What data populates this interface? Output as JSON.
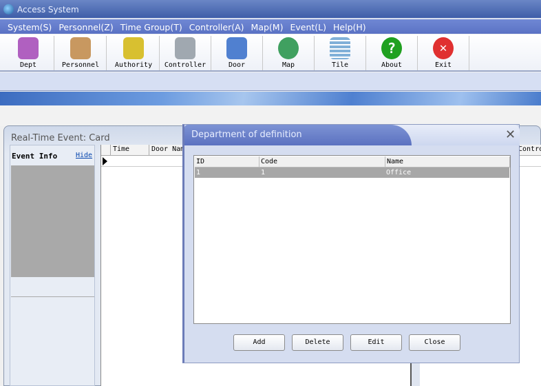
{
  "window": {
    "title": "Access System"
  },
  "menu": [
    "System(S)",
    "Personnel(Z)",
    "Time Group(T)",
    "Controller(A)",
    "Map(M)",
    "Event(L)",
    "Help(H)"
  ],
  "toolbar": [
    {
      "label": "Dept",
      "icon": "dept-icon",
      "color": "#b060c0"
    },
    {
      "label": "Personnel",
      "icon": "personnel-icon",
      "color": "#c89860"
    },
    {
      "label": "Authority",
      "icon": "authority-icon",
      "color": "#d8c030"
    },
    {
      "label": "Controller",
      "icon": "controller-icon",
      "color": "#a0a8b0"
    },
    {
      "label": "Door",
      "icon": "door-icon",
      "color": "#5080d0"
    },
    {
      "label": "Map",
      "icon": "map-icon",
      "color": "#40a060"
    },
    {
      "label": "Tile",
      "icon": "tile-icon",
      "color": "#80b0d8"
    },
    {
      "label": "About",
      "icon": "about-icon",
      "color": "#20a020"
    },
    {
      "label": "Exit",
      "icon": "exit-icon",
      "color": "#e03030"
    }
  ],
  "panel": {
    "title": "Real-Time Event: Card",
    "event_info": "Event Info",
    "hide": "Hide",
    "columns": [
      "Time",
      "Door Nam",
      "Contro"
    ]
  },
  "dialog": {
    "title": "Department of definition",
    "columns": [
      "ID",
      "Code",
      "Name"
    ],
    "rows": [
      {
        "id": "1",
        "code": "1",
        "name": "Office"
      }
    ],
    "buttons": {
      "add": "Add",
      "delete": "Delete",
      "edit": "Edit",
      "close": "Close"
    }
  }
}
